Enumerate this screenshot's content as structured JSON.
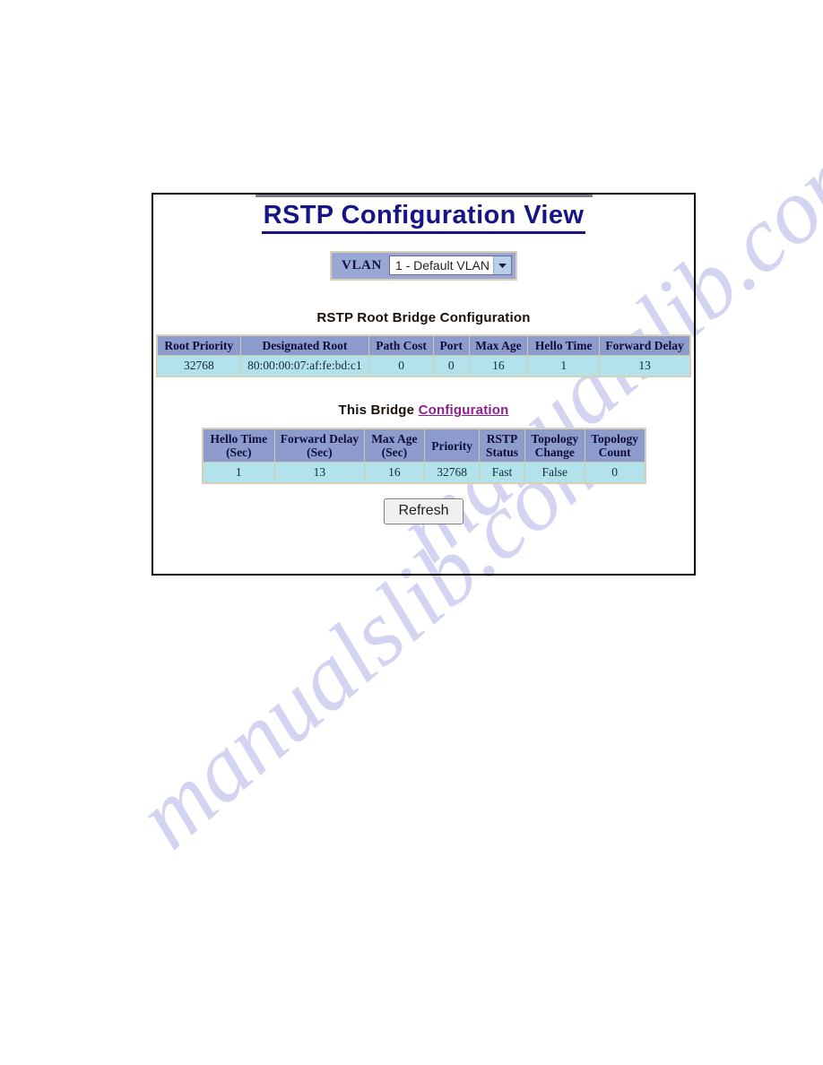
{
  "watermark": {
    "line1": "manualslib.com",
    "line2": "manualslib.com",
    "color": "#ccccf0"
  },
  "page": {
    "title": "RSTP Configuration View",
    "title_color": "#151585"
  },
  "vlan_selector": {
    "label": "VLAN",
    "selected_value": "1 - Default VLAN",
    "options": [
      "1 - Default VLAN"
    ],
    "dropdown_icon": "chevron-down-icon"
  },
  "root_bridge_section": {
    "heading": "RSTP Root Bridge Configuration",
    "columns": [
      "Root Priority",
      "Designated Root",
      "Path Cost",
      "Port",
      "Max Age",
      "Hello Time",
      "Forward Delay"
    ],
    "row": {
      "root_priority": "32768",
      "designated_root": "80:00:00:07:af:fe:bd:c1",
      "path_cost": "0",
      "port": "0",
      "max_age": "16",
      "hello_time": "1",
      "forward_delay": "13"
    }
  },
  "this_bridge_section": {
    "heading_prefix": "This Bridge ",
    "heading_link": "Configuration",
    "heading_link_color": "#8e1f8e",
    "columns": [
      "Hello Time\n(Sec)",
      "Forward Delay\n(Sec)",
      "Max Age\n(Sec)",
      "Priority",
      "RSTP\nStatus",
      "Topology\nChange",
      "Topology\nCount"
    ],
    "column_lines": {
      "hello_time_1": "Hello Time",
      "hello_time_2": "(Sec)",
      "forward_delay_1": "Forward Delay",
      "forward_delay_2": "(Sec)",
      "max_age_1": "Max Age",
      "max_age_2": "(Sec)",
      "priority": "Priority",
      "rstp_status_1": "RSTP",
      "rstp_status_2": "Status",
      "topology_change_1": "Topology",
      "topology_change_2": "Change",
      "topology_count_1": "Topology",
      "topology_count_2": "Count"
    },
    "row": {
      "hello_time": "1",
      "forward_delay": "13",
      "max_age": "16",
      "priority": "32768",
      "rstp_status": "Fast",
      "topology_change": "False",
      "topology_count": "0"
    }
  },
  "actions": {
    "refresh_label": "Refresh"
  },
  "colors": {
    "table_header_bg": "#8d9ccd",
    "table_cell_bg": "#b2e2ea",
    "table_border": "#d6d0b8",
    "vlan_box_bg": "#9aa6d4",
    "panel_border": "#000000"
  }
}
